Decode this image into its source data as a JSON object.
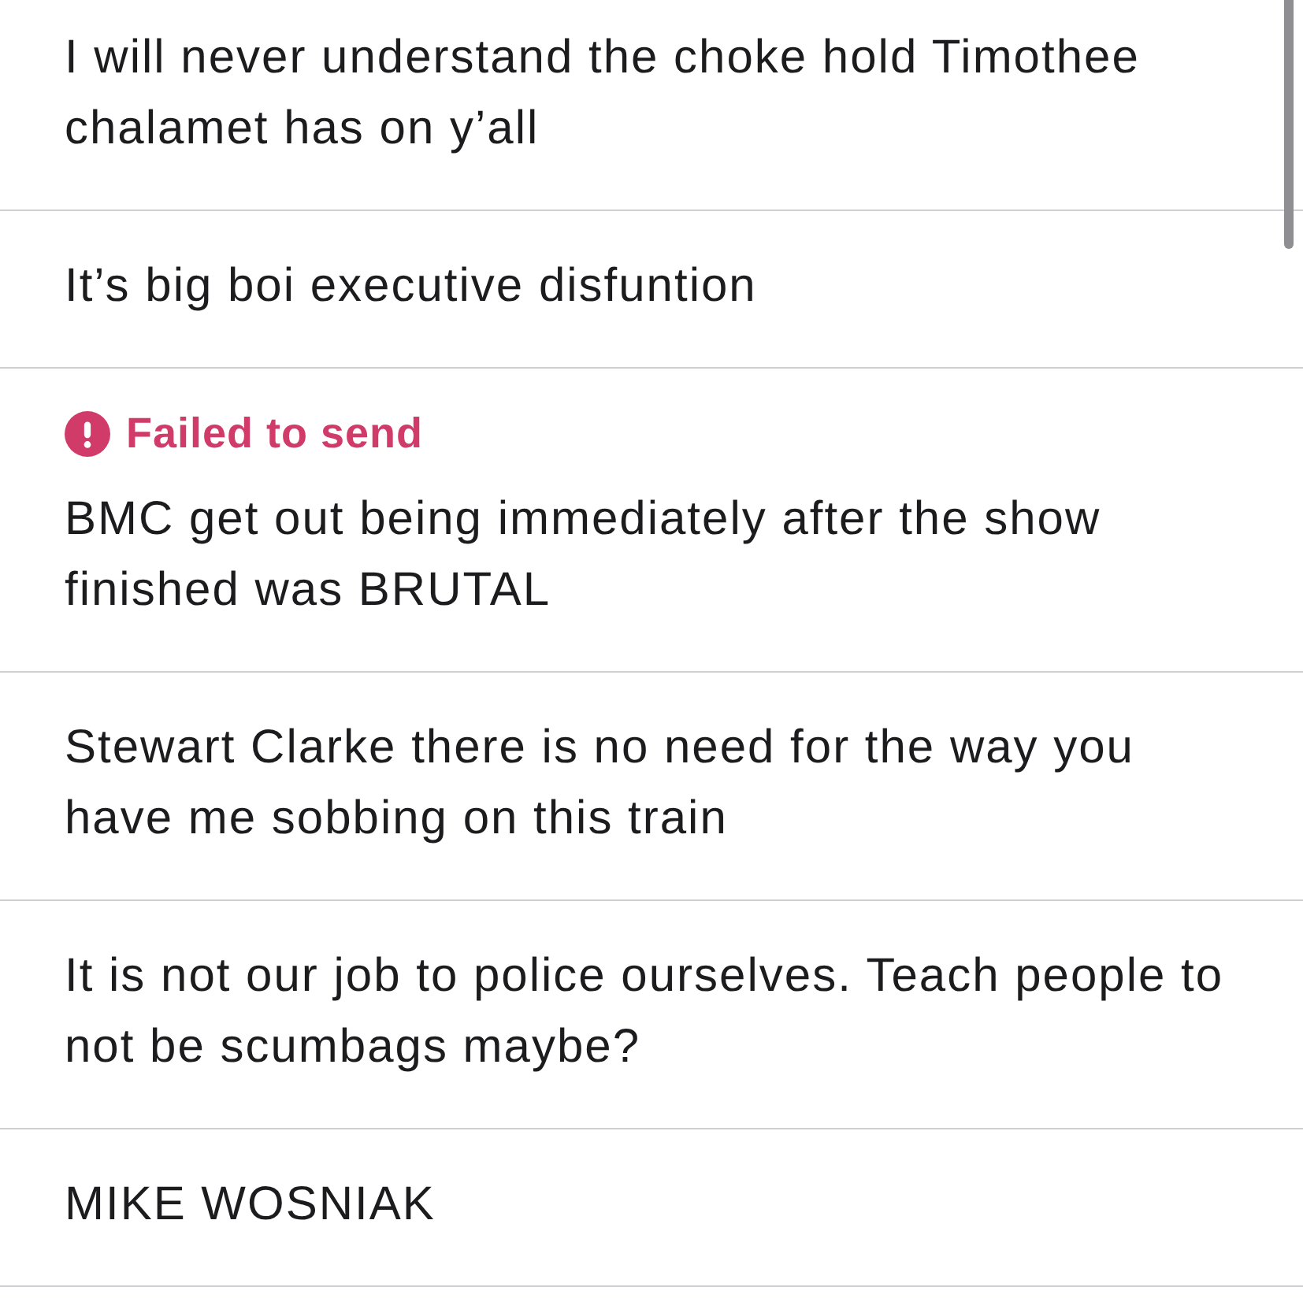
{
  "messages": [
    {
      "text": "I will never understand the choke hold Timothee chalamet has on y’all",
      "failed": false
    },
    {
      "text": "It’s big boi executive disfuntion",
      "failed": false
    },
    {
      "text": "BMC get out being immediately after the show finished was BRUTAL",
      "failed": true,
      "status": "Failed to send"
    },
    {
      "text": "Stewart Clarke there is no need for the way you have me sobbing on this train",
      "failed": false
    },
    {
      "text": "It is not our job to police ourselves. Teach people to not be scumbags maybe?",
      "failed": false
    },
    {
      "text": "MIKE WOSNIAK",
      "failed": false
    }
  ]
}
